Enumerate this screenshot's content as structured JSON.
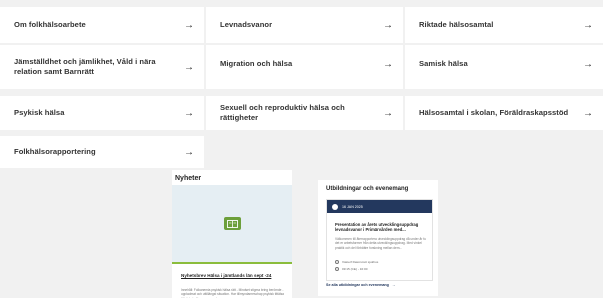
{
  "topics": [
    {
      "label": "Om folkhälsoarbete"
    },
    {
      "label": "Levnadsvanor"
    },
    {
      "label": "Riktade hälsosamtal"
    },
    {
      "label": "Jämställdhet och jämlikhet, Våld i nära relation samt Barnrätt"
    },
    {
      "label": "Migration och hälsa"
    },
    {
      "label": "Samisk hälsa"
    },
    {
      "label": "Psykisk hälsa"
    },
    {
      "label": "Sexuell och reproduktiv hälsa och rättigheter"
    },
    {
      "label": "Hälsosamtal i skolan, Föräldraskapsstöd"
    },
    {
      "label": "Folkhälsorapportering"
    }
  ],
  "arrow": "→",
  "news": {
    "heading": "Nyheter",
    "title": "Nyhetsbrev Hälsa i jämtlands län sept -24",
    "excerpt": "Innehåll: Folkanemia psykisk hälsa rätt - Mindset stigma bring berömde - uppladmat och uttillängst situation. Har tillmyndanreschap psykisk tittälsa Uttrödade för annonsen dag"
  },
  "events": {
    "heading": "Utbildningar och evenemang",
    "date": "16 JAN 2025",
    "title": "Presentation av årets utvecklingsuppdrag levnadsvanor i Primärvården med...",
    "description": "Välkommen till återrapportera utvecklingsuppdrag då under år fu det er arbetsformer från detta utvecklingsuppdrag. Med vinkel praktik och del förbättre forskning mellan dem...",
    "location": "Västerf Datorsmöt sjukhus",
    "time": "09:15 (CE) - 16:00",
    "see_all": "Se alla utbildningar och evenemang",
    "see_all_arrow": "→"
  }
}
